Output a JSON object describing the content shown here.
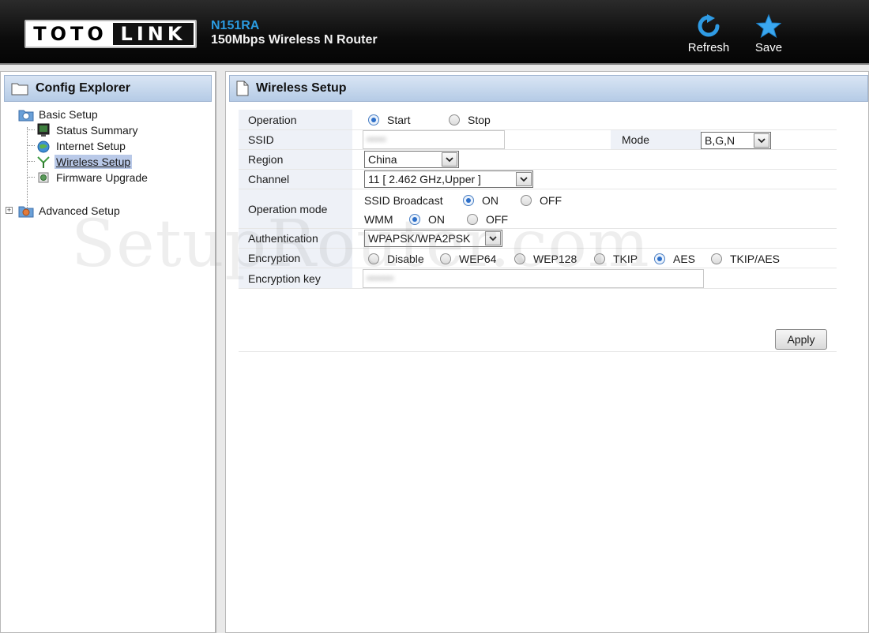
{
  "header": {
    "logo_left": "TOTO",
    "logo_right": "LINK",
    "model": "N151RA",
    "product": "150Mbps Wireless N Router",
    "refresh_label": "Refresh",
    "save_label": "Save",
    "icons": {
      "refresh": "refresh-icon",
      "save": "star-icon"
    },
    "accent_color": "#2a9be0"
  },
  "sidebar": {
    "title": "Config Explorer",
    "tree": {
      "basic_setup": "Basic Setup",
      "items": [
        {
          "label": "Status Summary",
          "icon": "monitor-icon"
        },
        {
          "label": "Internet Setup",
          "icon": "globe-icon"
        },
        {
          "label": "Wireless Setup",
          "icon": "antenna-icon",
          "selected": true
        },
        {
          "label": "Firmware Upgrade",
          "icon": "gear-icon"
        }
      ],
      "advanced_setup": "Advanced Setup"
    }
  },
  "main": {
    "title": "Wireless Setup",
    "operation": {
      "label": "Operation",
      "options": [
        "Start",
        "Stop"
      ],
      "selected": "Start"
    },
    "ssid": {
      "label": "SSID",
      "value": "•••••"
    },
    "mode": {
      "label": "Mode",
      "value": "B,G,N"
    },
    "region": {
      "label": "Region",
      "value": "China"
    },
    "channel": {
      "label": "Channel",
      "value": "11 [ 2.462 GHz,Upper ]"
    },
    "operation_mode": {
      "label": "Operation mode",
      "ssid_broadcast": {
        "label": "SSID Broadcast",
        "on": "ON",
        "off": "OFF",
        "selected": "ON"
      },
      "wmm": {
        "label": "WMM",
        "on": "ON",
        "off": "OFF",
        "selected": "ON"
      }
    },
    "authentication": {
      "label": "Authentication",
      "value": "WPAPSK/WPA2PSK"
    },
    "encryption": {
      "label": "Encryption",
      "options": [
        "Disable",
        "WEP64",
        "WEP128",
        "TKIP",
        "AES",
        "TKIP/AES"
      ],
      "selected": "AES"
    },
    "encryption_key": {
      "label": "Encryption key",
      "value": "•••••••"
    },
    "apply_label": "Apply"
  },
  "watermark": "SetupRouter.com"
}
